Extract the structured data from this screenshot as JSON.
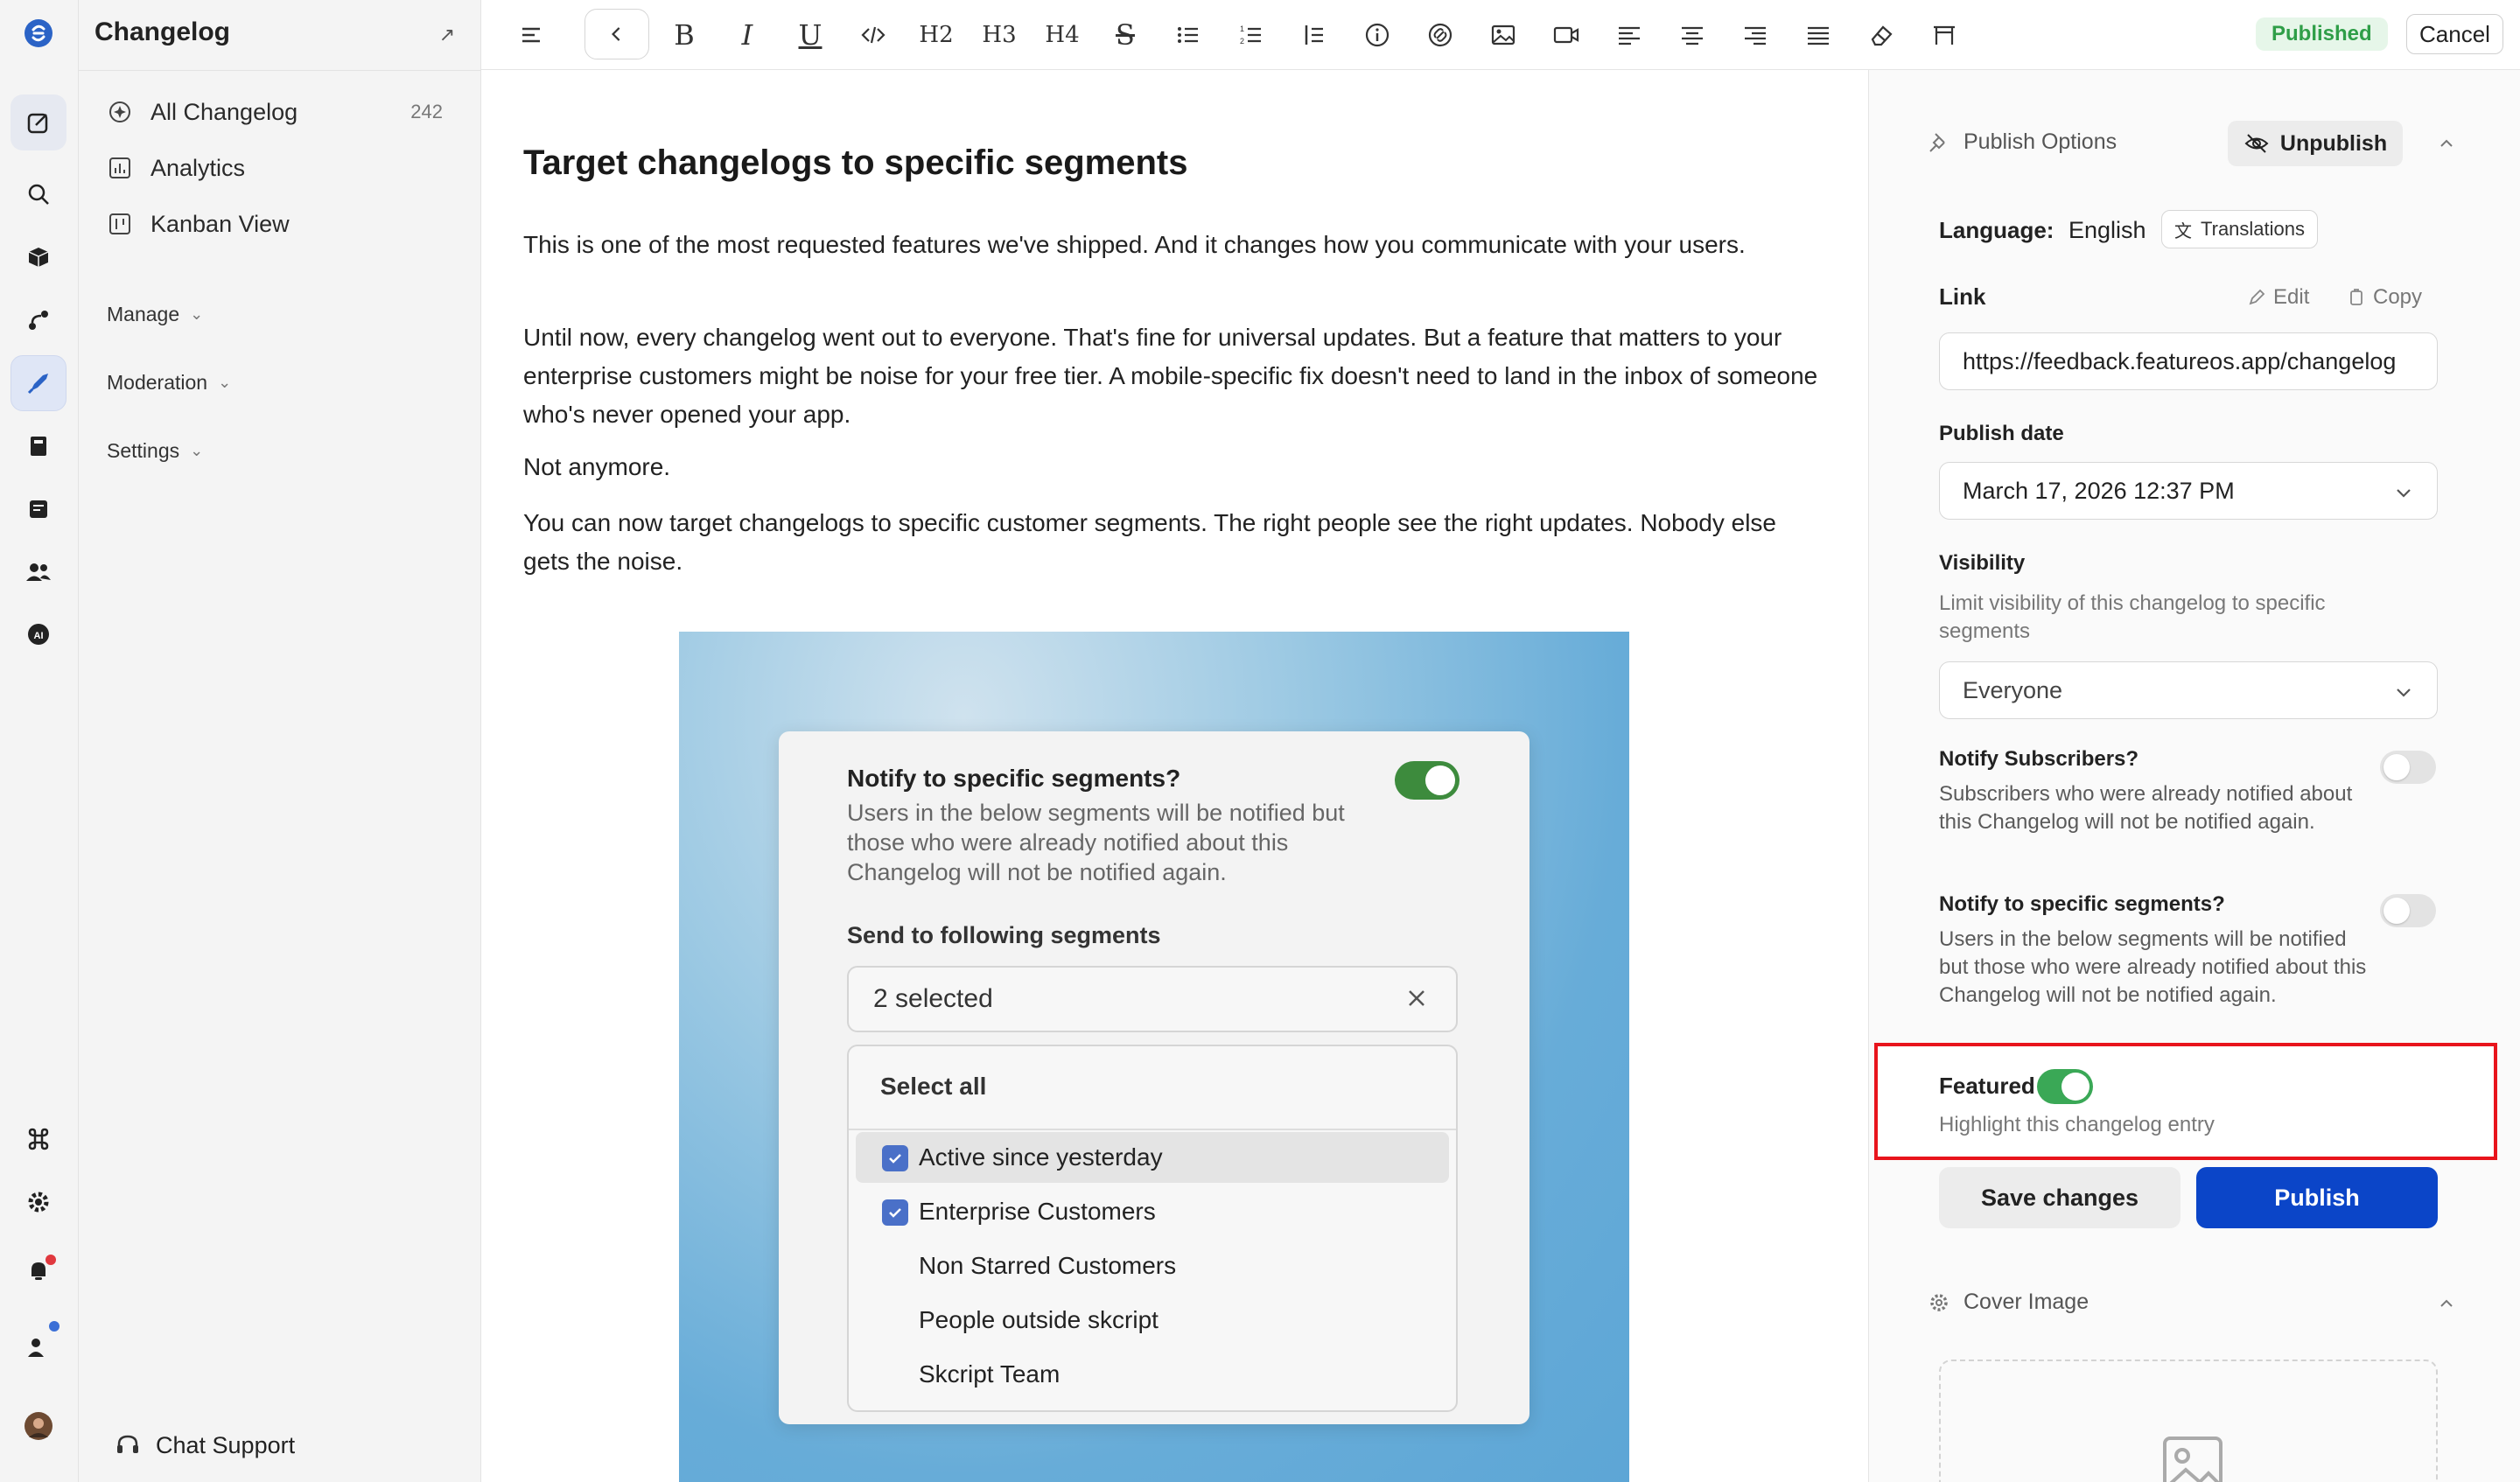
{
  "app": {
    "section_title": "Changelog"
  },
  "sidebar": {
    "items": [
      {
        "label": "All Changelog",
        "count": "242",
        "icon": "sparkle-icon"
      },
      {
        "label": "Analytics",
        "icon": "chart-icon"
      },
      {
        "label": "Kanban View",
        "icon": "kanban-icon"
      }
    ],
    "groups": [
      {
        "label": "Manage"
      },
      {
        "label": "Moderation"
      },
      {
        "label": "Settings"
      }
    ],
    "chat_support": "Chat Support"
  },
  "toolbar": {
    "status_badge": "Published",
    "cancel_label": "Cancel",
    "heading_buttons": [
      "H2",
      "H3",
      "H4"
    ]
  },
  "post": {
    "title": "Target changelogs to specific segments",
    "paragraphs": [
      "This is one of the most requested features we've shipped. And it changes how you communicate with your users.",
      "Until now, every changelog went out to everyone. That's fine for universal updates. But a feature that matters to your enterprise customers might be noise for your free tier. A mobile-specific fix doesn't need to land in the inbox of someone who's never opened your app.",
      "Not anymore.",
      "You can now target changelogs to specific customer segments. The right people see the right updates. Nobody else gets the noise."
    ]
  },
  "hero_modal": {
    "title": "Notify to specific segments?",
    "description": "Users in the below segments will be notified but those who were already notified about this Changelog will not be notified again.",
    "send_label": "Send to following segments",
    "selected_text": "2 selected",
    "select_all": "Select all",
    "options": [
      {
        "label": "Active since yesterday",
        "checked": true
      },
      {
        "label": "Enterprise Customers",
        "checked": true
      },
      {
        "label": "Non Starred Customers",
        "checked": false
      },
      {
        "label": "People outside skcript",
        "checked": false
      },
      {
        "label": "Skcript Team",
        "checked": false
      }
    ]
  },
  "panel": {
    "publish_options_title": "Publish Options",
    "unpublish_label": "Unpublish",
    "language_label": "Language:",
    "language_value": "English",
    "translations_label": "Translations",
    "link_label": "Link",
    "edit_label": "Edit",
    "copy_label": "Copy",
    "link_value": "https://feedback.featureos.app/changelog",
    "publish_date_label": "Publish date",
    "publish_date_value": "March 17, 2026 12:37 PM",
    "visibility_label": "Visibility",
    "visibility_help": "Limit visibility of this changelog to specific segments",
    "visibility_value": "Everyone",
    "notify_subscribers_label": "Notify Subscribers?",
    "notify_subscribers_help": "Subscribers who were already notified about this Changelog will not be notified again.",
    "notify_segments_label": "Notify to specific segments?",
    "notify_segments_help": "Users in the below segments will be notified but those who were already notified about this Changelog will not be notified again.",
    "featured_label": "Featured",
    "featured_help": "Highlight this changelog entry",
    "featured_on": true,
    "save_label": "Save changes",
    "publish_label": "Publish",
    "cover_image_title": "Cover Image"
  },
  "colors": {
    "primary": "#0b45c8",
    "success": "#3aa856",
    "highlight_border": "#e8141c"
  }
}
